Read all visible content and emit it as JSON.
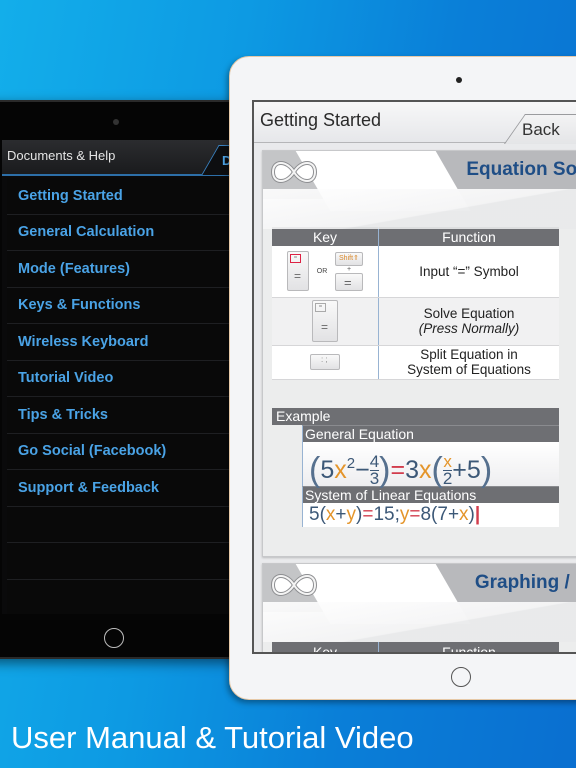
{
  "tagline": "User Manual & Tutorial Video",
  "colors": {
    "accent_blue": "#4aa3e6",
    "section_title": "#1f4e86",
    "variable_orange": "#e4952b",
    "equals_red": "#d23c4c",
    "background_blue": "#0d9ae3"
  },
  "left_device": {
    "header_title": "Documents & Help",
    "header_tab_partial": "D",
    "menu": [
      {
        "label": "Getting Started"
      },
      {
        "label": "General Calculation"
      },
      {
        "label": "Mode (Features)"
      },
      {
        "label": "Keys & Functions"
      },
      {
        "label": "Wireless Keyboard"
      },
      {
        "label": "Tutorial Video"
      },
      {
        "label": "Tips & Tricks"
      },
      {
        "label": "Go Social (Facebook)"
      },
      {
        "label": "Support & Feedback"
      }
    ]
  },
  "right_device": {
    "header_title": "Getting Started",
    "back_label": "Back",
    "sections": [
      {
        "title": "Equation Solver",
        "icon": "infinity-icon",
        "table": {
          "headers": [
            "Key",
            "Function"
          ],
          "rows": [
            {
              "key_desc": "= key or Shift + = key",
              "or_label": "OR",
              "shift_label": "Shift⇑",
              "plus_label": "+",
              "function": "Input “=” Symbol"
            },
            {
              "key_desc": "= key",
              "function": "Solve Equation",
              "function_note": "(Press Normally)"
            },
            {
              "key_desc": ": ; key",
              "function_line1": "Split Equation in",
              "function_line2": "System of Equations"
            }
          ]
        },
        "example": {
          "header": "Example",
          "items": [
            {
              "label": "General Equation",
              "expression": "(5x²−4/3)=3x(x/2+5)"
            },
            {
              "label": "System of Linear Equations",
              "expression": "5(x+y)=15;y=8(7+x)"
            }
          ]
        }
      },
      {
        "title": "Graphing / Plot",
        "icon": "infinity-icon",
        "table": {
          "headers": [
            "Key",
            "Function"
          ]
        }
      }
    ]
  }
}
